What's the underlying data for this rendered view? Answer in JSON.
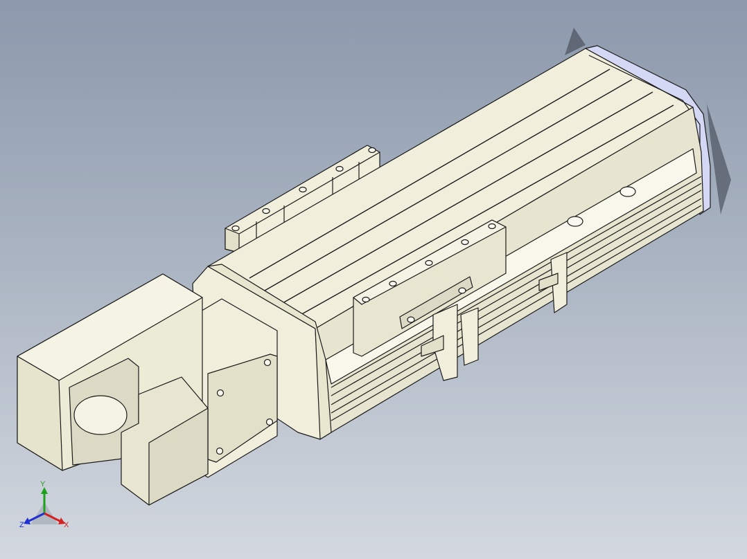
{
  "viewport": {
    "background_top": "#8c99ac",
    "background_bottom": "#d3d8df"
  },
  "model": {
    "body_color": "#f1efdc",
    "shade_color": "#e2e0c8",
    "dark_shade_color": "#cfcdb4",
    "endcap_color": "#d4d8f4",
    "motor_color": "#ecebd6",
    "edge_color": "#1a1a1a"
  },
  "triad": {
    "y_label": "Y",
    "x_label": "X",
    "z_label": "Z",
    "y_color": "#1fa01f",
    "x_color": "#d42020",
    "z_color": "#2030d0",
    "icon": "coordinate-triad-icon"
  }
}
